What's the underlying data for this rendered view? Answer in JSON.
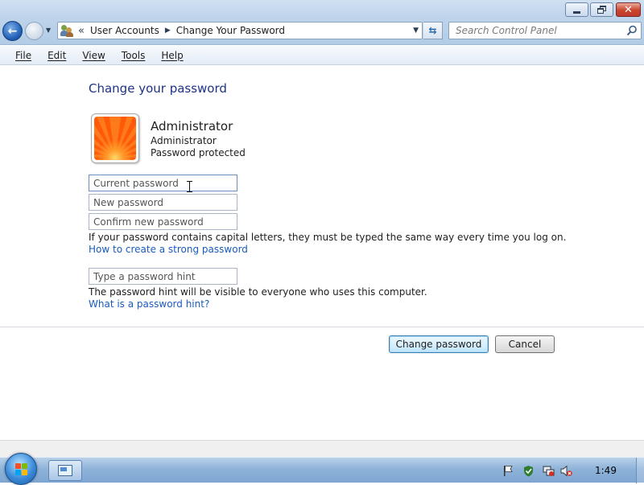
{
  "window": {
    "minimize": "minimize",
    "maximize": "restore",
    "close": "close"
  },
  "address": {
    "overflow": "«",
    "crumbs": [
      "User Accounts",
      "Change Your Password"
    ],
    "search_placeholder": "Search Control Panel"
  },
  "menu": {
    "items": [
      "File",
      "Edit",
      "View",
      "Tools",
      "Help"
    ]
  },
  "content": {
    "heading": "Change your password",
    "user": {
      "name": "Administrator",
      "role": "Administrator",
      "status": "Password protected"
    },
    "fields": {
      "current_placeholder": "Current password",
      "new_placeholder": "New password",
      "confirm_placeholder": "Confirm new password",
      "hint_placeholder": "Type a password hint"
    },
    "notes": {
      "caps": "If your password contains capital letters, they must be typed the same way every time you log on.",
      "strong_link": "How to create a strong password",
      "hint_note": "The password hint will be visible to everyone who uses this computer.",
      "hint_link": "What is a password hint?"
    },
    "buttons": {
      "change": "Change password",
      "cancel": "Cancel"
    }
  },
  "taskbar": {
    "clock": "1:49"
  },
  "colors": {
    "heading": "#1e3287",
    "link": "#1a5bbf",
    "accent": "#3c7fb1"
  }
}
